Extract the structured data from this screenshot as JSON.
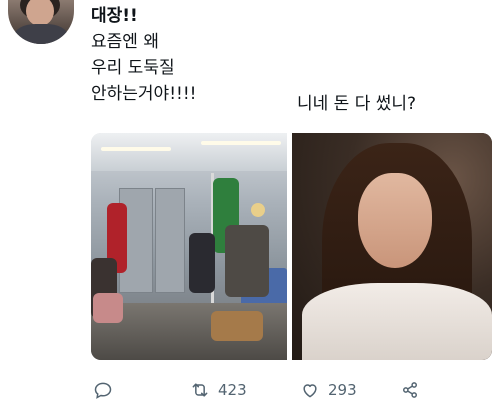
{
  "tweet": {
    "lines": [
      "대장!!",
      "요즘엔 왜",
      "우리 도둑질",
      "안하는거야!!!!"
    ],
    "reply": "니네 돈 다 썼니?"
  },
  "actions": {
    "reply_icon": "reply-icon",
    "retweet_icon": "retweet-icon",
    "retweet_count": "423",
    "like_icon": "heart-icon",
    "like_count": "293",
    "share_icon": "share-icon"
  },
  "colors": {
    "text": "#0f1419",
    "muted": "#536471"
  }
}
